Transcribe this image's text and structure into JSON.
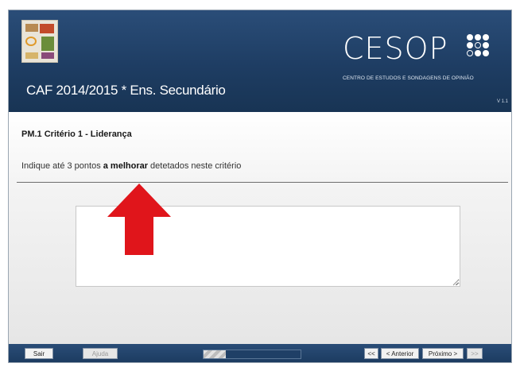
{
  "header": {
    "app_title": "CAF 2014/2015 * Ens. Secundário",
    "brand_name": "CESOP",
    "brand_subtitle": "CENTRO DE ESTUDOS E SONDAGENS DE OPINIÃO",
    "version": "V 1.1"
  },
  "question": {
    "title": "PM.1 Critério 1 - Liderança",
    "text_before": "Indique até 3 pontos ",
    "text_emphasis": "a melhorar",
    "text_after": " detetados neste critério",
    "answer_value": ""
  },
  "annotation": {
    "arrow_color": "#e0151b"
  },
  "footer": {
    "exit_label": "Sair",
    "help_label": "Ajuda",
    "first_label": "<<",
    "previous_label": "< Anterior",
    "next_label": "Próximo >",
    "last_label": ">>",
    "progress_fraction": 0.23
  },
  "colors": {
    "header_bg": "#1e3d63",
    "footer_bg": "#1b3a5f"
  }
}
